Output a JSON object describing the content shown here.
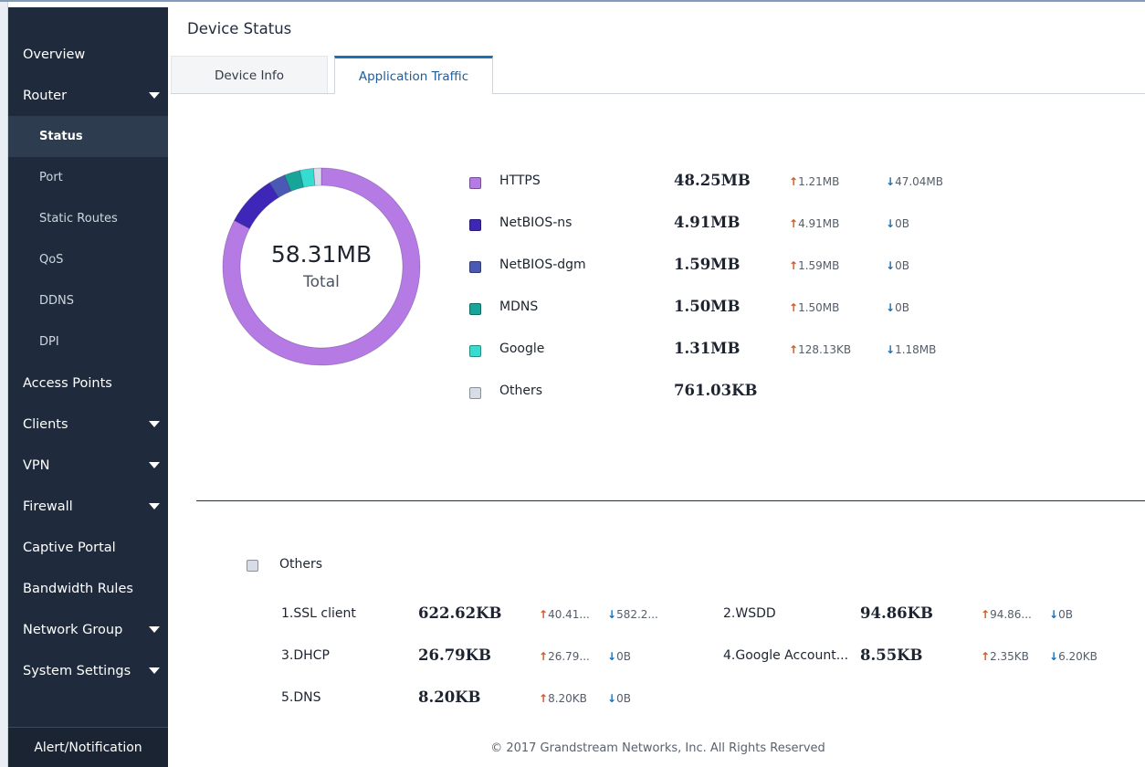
{
  "sidebar": {
    "items": [
      {
        "label": "Overview"
      },
      {
        "label": "Router"
      },
      {
        "label": "Status"
      },
      {
        "label": "Port"
      },
      {
        "label": "Static Routes"
      },
      {
        "label": "QoS"
      },
      {
        "label": "DDNS"
      },
      {
        "label": "DPI"
      },
      {
        "label": "Access Points"
      },
      {
        "label": "Clients"
      },
      {
        "label": "VPN"
      },
      {
        "label": "Firewall"
      },
      {
        "label": "Captive Portal"
      },
      {
        "label": "Bandwidth Rules"
      },
      {
        "label": "Network Group"
      },
      {
        "label": "System Settings"
      }
    ],
    "alert_label": "Alert/Notification"
  },
  "header": {
    "title": "Device Status",
    "tabs": [
      {
        "label": "Device Info"
      },
      {
        "label": "Application Traffic"
      }
    ]
  },
  "donut": {
    "total": "58.31MB",
    "total_label": "Total",
    "segments": [
      {
        "name": "HTTPS",
        "color": "#b57ae4",
        "value_mb": 48.25
      },
      {
        "name": "NetBIOS-ns",
        "color": "#3d26b8",
        "value_mb": 4.91
      },
      {
        "name": "NetBIOS-dgm",
        "color": "#4a59b3",
        "value_mb": 1.59
      },
      {
        "name": "MDNS",
        "color": "#16a699",
        "value_mb": 1.5
      },
      {
        "name": "Google",
        "color": "#35ddd0",
        "value_mb": 1.31
      },
      {
        "name": "Others",
        "color": "#d7dde6",
        "value_mb": 0.74
      }
    ]
  },
  "legend": [
    {
      "name": "HTTPS",
      "size": "48.25MB",
      "up": "1.21MB",
      "down": "47.04MB",
      "color": "#b57ae4"
    },
    {
      "name": "NetBIOS-ns",
      "size": "4.91MB",
      "up": "4.91MB",
      "down": "0B",
      "color": "#3d26b8"
    },
    {
      "name": "NetBIOS-dgm",
      "size": "1.59MB",
      "up": "1.59MB",
      "down": "0B",
      "color": "#4a59b3"
    },
    {
      "name": "MDNS",
      "size": "1.50MB",
      "up": "1.50MB",
      "down": "0B",
      "color": "#16a699"
    },
    {
      "name": "Google",
      "size": "1.31MB",
      "up": "128.13KB",
      "down": "1.18MB",
      "color": "#35ddd0"
    },
    {
      "name": "Others",
      "size": "761.03KB",
      "color": "#d7dde6"
    }
  ],
  "others": {
    "title": "Others",
    "items": [
      {
        "name": "1.SSL client",
        "size": "622.62KB",
        "up": "40.41...",
        "down": "582.2..."
      },
      {
        "name": "2.WSDD",
        "size": "94.86KB",
        "up": "94.86...",
        "down": "0B"
      },
      {
        "name": "3.DHCP",
        "size": "26.79KB",
        "up": "26.79...",
        "down": "0B"
      },
      {
        "name": "4.Google Account...",
        "size": "8.55KB",
        "up": "2.35KB",
        "down": "6.20KB"
      },
      {
        "name": "5.DNS",
        "size": "8.20KB",
        "up": "8.20KB",
        "down": "0B"
      }
    ]
  },
  "footer": {
    "copyright": "© 2017 Grandstream Networks, Inc. All Rights Reserved"
  }
}
